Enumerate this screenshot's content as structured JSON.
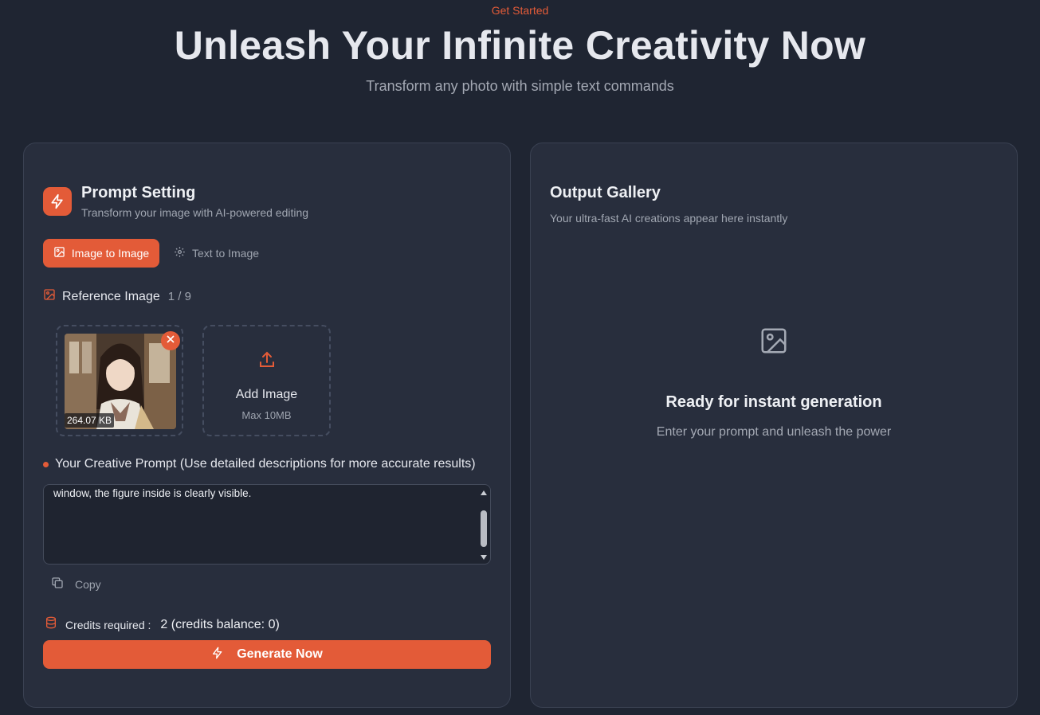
{
  "hero": {
    "eyebrow": "Get Started",
    "title": "Unleash Your Infinite Creativity Now",
    "subtitle": "Transform any photo with simple text commands"
  },
  "prompt_setting": {
    "title": "Prompt Setting",
    "subtitle": "Transform your image with AI-powered editing",
    "icon": "lightning-icon",
    "tabs": [
      {
        "label": "Image to Image",
        "icon": "image-icon",
        "active": true
      },
      {
        "label": "Text to Image",
        "icon": "gear-icon",
        "active": false
      }
    ],
    "reference": {
      "label": "Reference Image",
      "count": "1 / 9",
      "thumbnail_size": "264.07 KB",
      "add_label": "Add Image",
      "add_max": "Max 10MB"
    },
    "prompt": {
      "label": "Your Creative Prompt (Use detailed descriptions for more accurate results)",
      "value": "realistic style, in a real environment. The figurine is placed on a computer desk. The figurine has a round transparent acrylic base, with no text on the base. The content on the computer screen is the Blender modeling process of this figurine. Next to the computer screen is a packaging box with rounded corner design and a transparent front window, the figure inside is clearly visible.",
      "copy_label": "Copy"
    },
    "credits": {
      "label": "Credits required :",
      "value": "2 (credits balance: 0)"
    },
    "generate_label": "Generate Now"
  },
  "output_gallery": {
    "title": "Output Gallery",
    "subtitle": "Your ultra-fast AI creations appear here instantly",
    "empty_title": "Ready for instant generation",
    "empty_hint": "Enter your prompt and unleash the power"
  },
  "colors": {
    "accent": "#e35b38",
    "background": "#1f2532",
    "panel": "#282e3d"
  }
}
